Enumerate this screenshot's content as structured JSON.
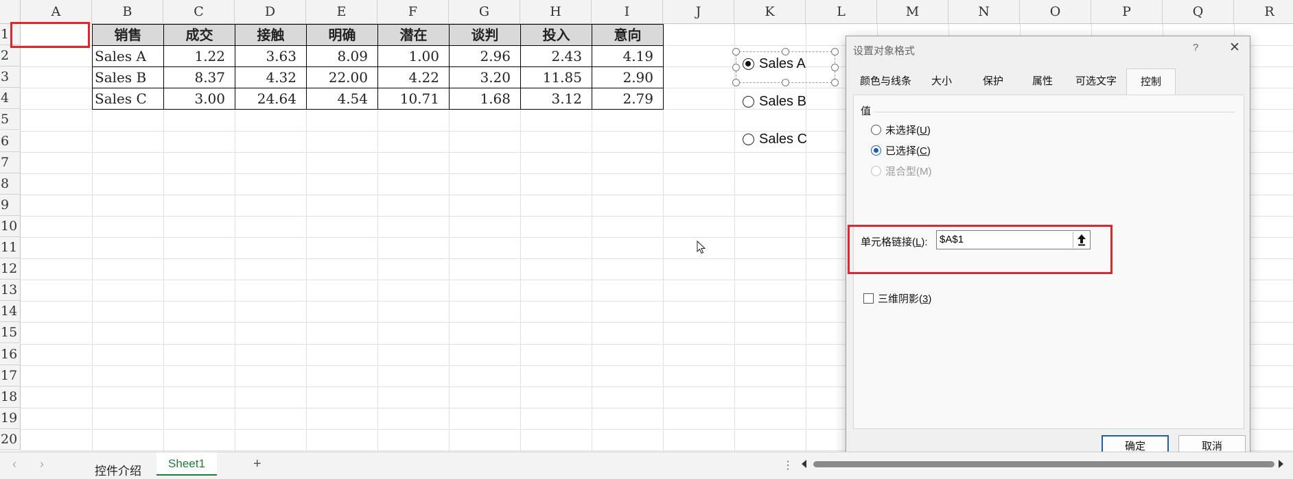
{
  "sheet": {
    "columns": [
      "A",
      "B",
      "C",
      "D",
      "E",
      "F",
      "G",
      "H",
      "I",
      "J",
      "K",
      "L",
      "M",
      "N",
      "O",
      "P",
      "Q",
      "R"
    ],
    "rows": [
      "1",
      "2",
      "3",
      "4",
      "5",
      "6",
      "7",
      "8",
      "9",
      "10",
      "11",
      "12",
      "13",
      "14",
      "15",
      "16",
      "17",
      "18",
      "19",
      "20"
    ],
    "headers": [
      "销售",
      "成交",
      "接触",
      "明确",
      "潜在",
      "谈判",
      "投入",
      "意向"
    ],
    "data": [
      [
        "Sales A",
        "1.22",
        "3.63",
        "8.09",
        "1.00",
        "2.96",
        "2.43",
        "4.19"
      ],
      [
        "Sales B",
        "8.37",
        "4.32",
        "22.00",
        "4.22",
        "3.20",
        "11.85",
        "2.90"
      ],
      [
        "Sales C",
        "3.00",
        "24.64",
        "4.54",
        "10.71",
        "1.68",
        "3.12",
        "2.79"
      ]
    ]
  },
  "option_buttons": [
    {
      "label": "Sales A",
      "selected": true
    },
    {
      "label": "Sales B",
      "selected": false
    },
    {
      "label": "Sales C",
      "selected": false
    }
  ],
  "dialog": {
    "title": "设置对象格式",
    "help": "?",
    "close": "✕",
    "tabs": [
      "颜色与线条",
      "大小",
      "保护",
      "属性",
      "可选文字",
      "控制"
    ],
    "active_tab": "控制",
    "value_group": "值",
    "radio_unchecked": {
      "text": "未选择(",
      "key": "U",
      "end": ")"
    },
    "radio_checked": {
      "text": "已选择(",
      "key": "C",
      "end": ")"
    },
    "radio_mixed": "混合型(M)",
    "cell_link_label": {
      "text": "单元格链接(",
      "key": "L",
      "end": "):"
    },
    "cell_link_value": "$A$1",
    "shading_label": {
      "text": "三维阴影(",
      "key": "3",
      "end": ")"
    },
    "ok": "确定",
    "cancel": "取消"
  },
  "tabbar": {
    "sheets": [
      "控件介绍",
      "Sheet1"
    ],
    "active": "Sheet1",
    "add": "+"
  },
  "colors": {
    "highlight": "#e0262b",
    "accent": "#1a5fb4"
  }
}
